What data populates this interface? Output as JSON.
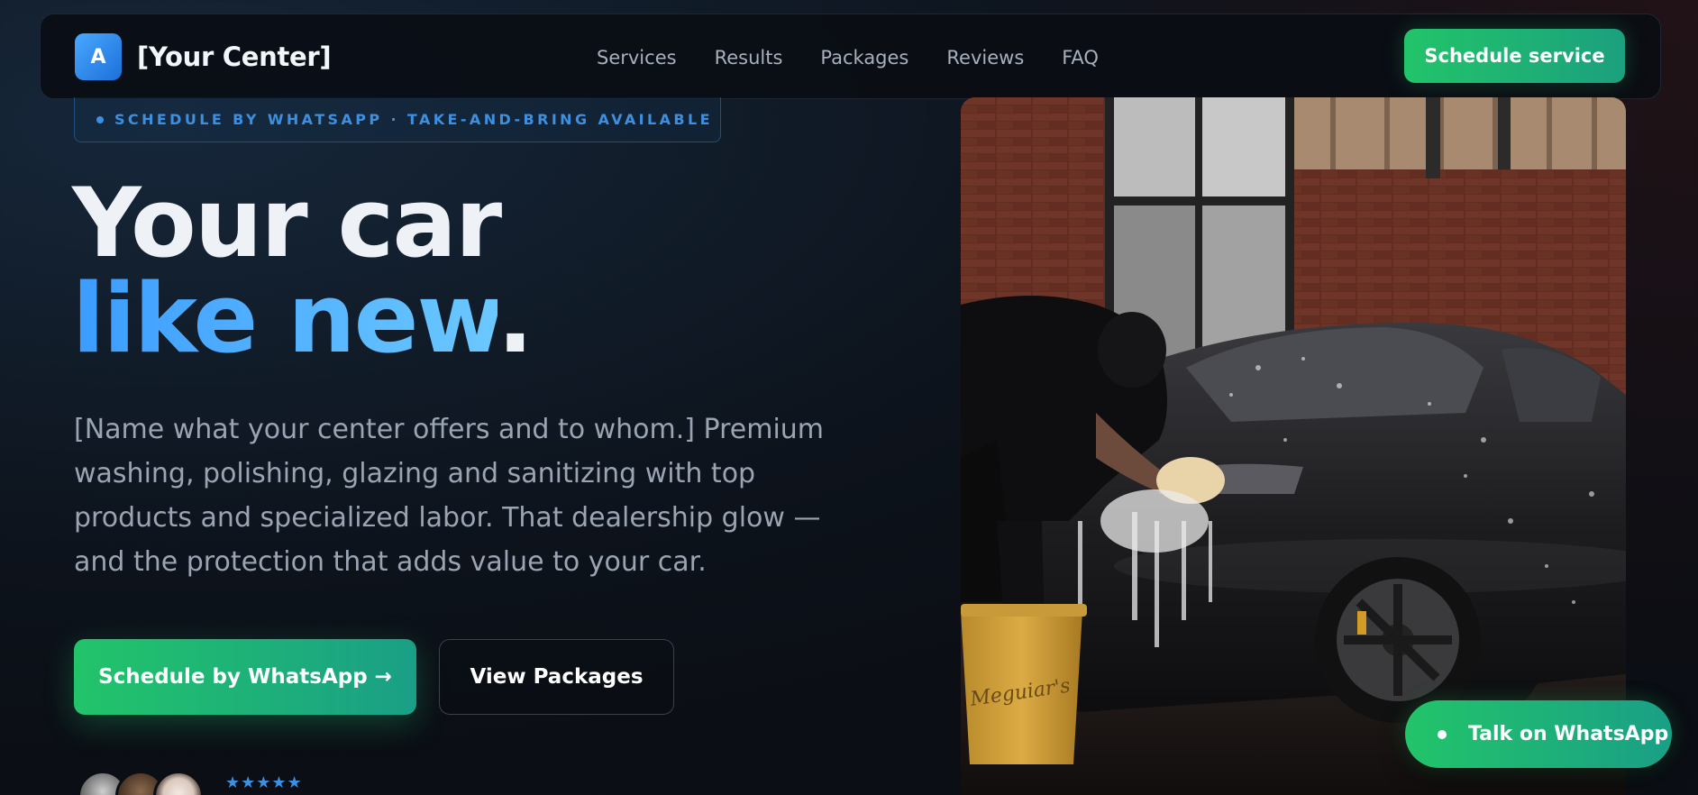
{
  "nav": {
    "logo_letter": "A",
    "brand": "[Your Center]",
    "links": [
      "Services",
      "Results",
      "Packages",
      "Reviews",
      "FAQ"
    ],
    "cta": "Schedule service"
  },
  "badge": {
    "text": "SCHEDULE BY WHATSAPP · TAKE-AND-BRING AVAILABLE"
  },
  "hero": {
    "title_line1": "Your car",
    "title_line2_accent": "like new",
    "title_line2_end": ".",
    "description": "[Name what your center offers and to whom.] Premium washing, polishing, glazing and sanitizing with top products and specialized labor. That dealership glow — and the protection that adds value to your car.",
    "primary_button": "Schedule by WhatsApp →",
    "secondary_button": "View Packages",
    "rating_stars": "★★★★★"
  },
  "floating": {
    "whatsapp_label": "Talk on WhatsApp"
  },
  "colors": {
    "accent_blue": "#3c9cff",
    "accent_green": "#22c46a",
    "background": "#0b0e14"
  }
}
